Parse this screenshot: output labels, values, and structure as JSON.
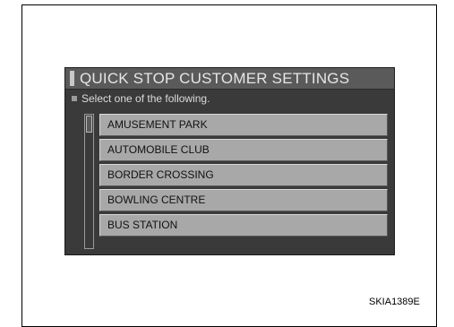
{
  "screen": {
    "title": "QUICK STOP CUSTOMER SETTINGS",
    "instruction": "Select one of the following.",
    "options": [
      "AMUSEMENT PARK",
      "AUTOMOBILE CLUB",
      "BORDER CROSSING",
      "BOWLING CENTRE",
      "BUS STATION"
    ]
  },
  "figure_code": "SKIA1389E"
}
